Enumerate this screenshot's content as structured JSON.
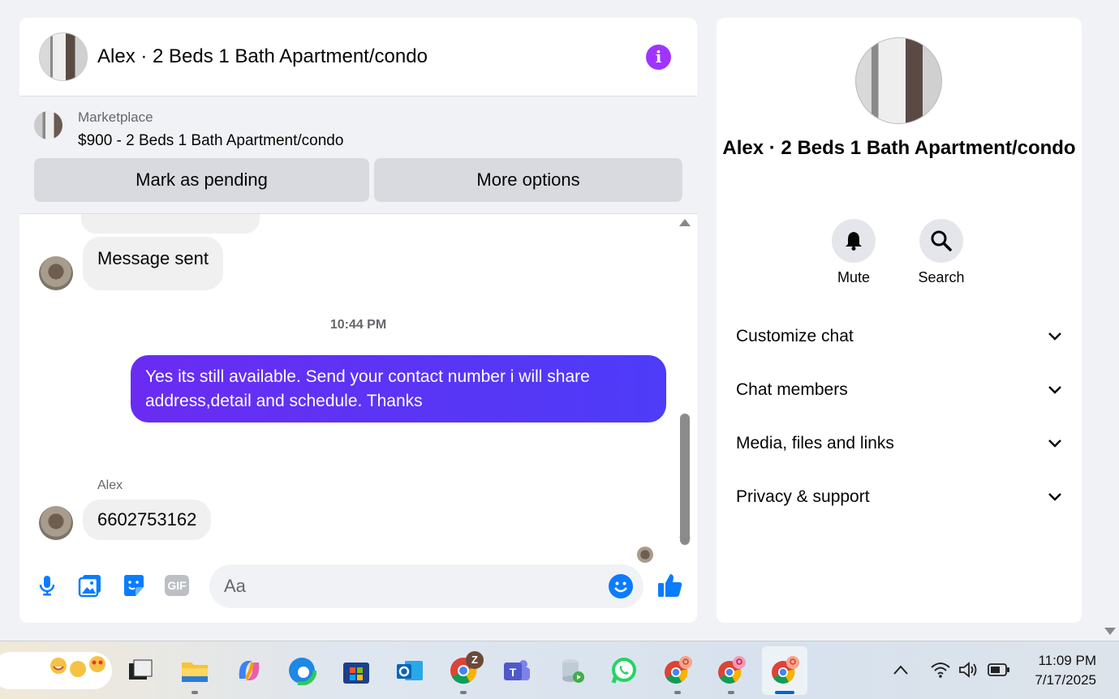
{
  "chat": {
    "title": "Alex · 2 Beds 1 Bath Apartment/condo",
    "info_icon": "i",
    "listing": {
      "label": "Marketplace",
      "title": "$900 - 2 Beds 1 Bath Apartment/condo",
      "mark_pending": "Mark as pending",
      "more_options": "More options"
    },
    "messages": {
      "msg1": "Message sent",
      "timestamp": "10:44 PM",
      "outgoing": "Yes its still available. Send your contact number i will share address,detail and schedule. Thanks",
      "sender": "Alex",
      "msg2": "6602753162"
    },
    "composer": {
      "placeholder": "Aa",
      "icons": [
        "mic-icon",
        "photo-icon",
        "sticker-icon",
        "gif-icon",
        "emoji-icon",
        "thumbs-up-icon"
      ],
      "gif_label": "GIF"
    }
  },
  "info": {
    "title": "Alex · 2 Beds 1 Bath Apartment/condo",
    "mute": "Mute",
    "search": "Search",
    "sections": [
      "Customize chat",
      "Chat members",
      "Media, files and links",
      "Privacy & support"
    ]
  },
  "taskbar": {
    "time": "11:09 PM",
    "date": "7/17/2025",
    "apps": [
      "task-view",
      "file-explorer",
      "copilot",
      "edge",
      "microsoft-store",
      "outlook",
      "chrome-z",
      "teams",
      "database-app",
      "whatsapp",
      "chrome-profile-1",
      "chrome-profile-2",
      "chrome-profile-3"
    ],
    "chrome_badge": "Z"
  },
  "colors": {
    "accent_purple": "#a033ff",
    "bubble_gradient_start": "#6a2cf2",
    "bubble_gradient_end": "#4d3cf8",
    "messenger_blue": "#0a7cff"
  }
}
